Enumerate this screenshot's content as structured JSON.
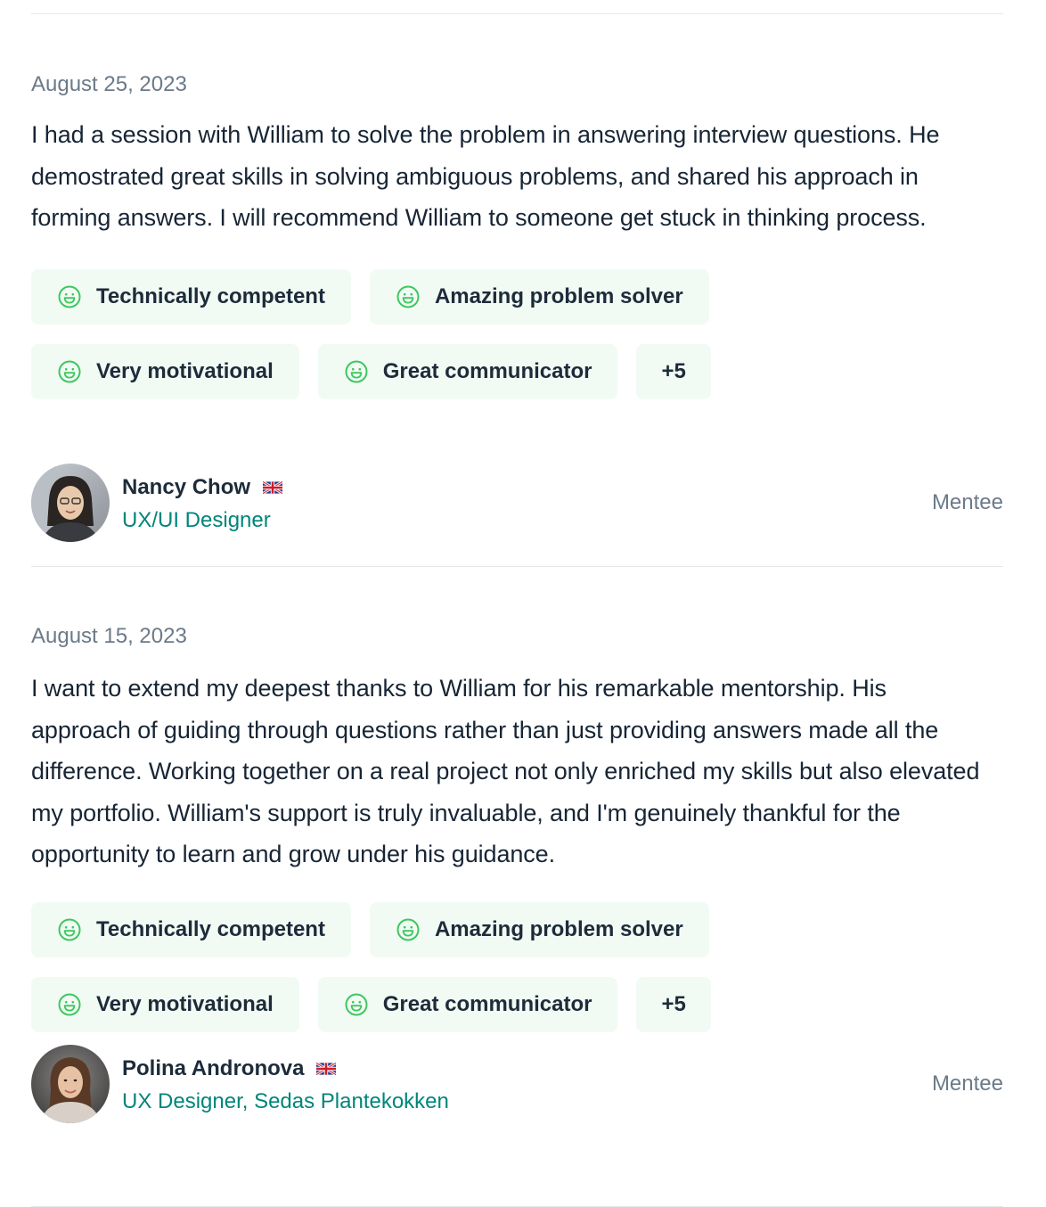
{
  "colors": {
    "accent_text": "#00857a",
    "chip_background": "#f1fbf4",
    "smile_icon": "#3fc75f",
    "muted_text": "#6b7a88",
    "divider": "#e4e7eb"
  },
  "reviews": [
    {
      "date": "August 25, 2023",
      "text": "I had a session with William to solve the problem in answering interview questions. He demostrated great skills in solving ambiguous problems, and shared his approach in forming answers. I will recommend William to someone get stuck in thinking process.",
      "tags": [
        {
          "label": "Technically competent",
          "icon": "smile-icon"
        },
        {
          "label": "Amazing problem solver",
          "icon": "smile-icon"
        },
        {
          "label": "Very motivational",
          "icon": "smile-icon"
        },
        {
          "label": "Great communicator",
          "icon": "smile-icon"
        }
      ],
      "more_tags": "+5",
      "author": {
        "name": "Nancy Chow",
        "flag": "uk-flag-icon",
        "role": "UX/UI Designer",
        "type": "Mentee"
      }
    },
    {
      "date": "August 15, 2023",
      "text": "I want to extend my deepest thanks to William for his remarkable mentorship. His approach of guiding through questions rather than just providing answers made all the difference. Working together on a real project not only enriched my skills but also elevated my portfolio. William's support is truly invaluable, and I'm genuinely thankful for the opportunity to learn and grow under his guidance.",
      "tags": [
        {
          "label": "Technically competent",
          "icon": "smile-icon"
        },
        {
          "label": "Amazing problem solver",
          "icon": "smile-icon"
        },
        {
          "label": "Very motivational",
          "icon": "smile-icon"
        },
        {
          "label": "Great communicator",
          "icon": "smile-icon"
        }
      ],
      "more_tags": "+5",
      "author": {
        "name": "Polina Andronova",
        "flag": "uk-flag-icon",
        "role": "UX Designer, Sedas Plantekokken",
        "type": "Mentee"
      }
    }
  ]
}
